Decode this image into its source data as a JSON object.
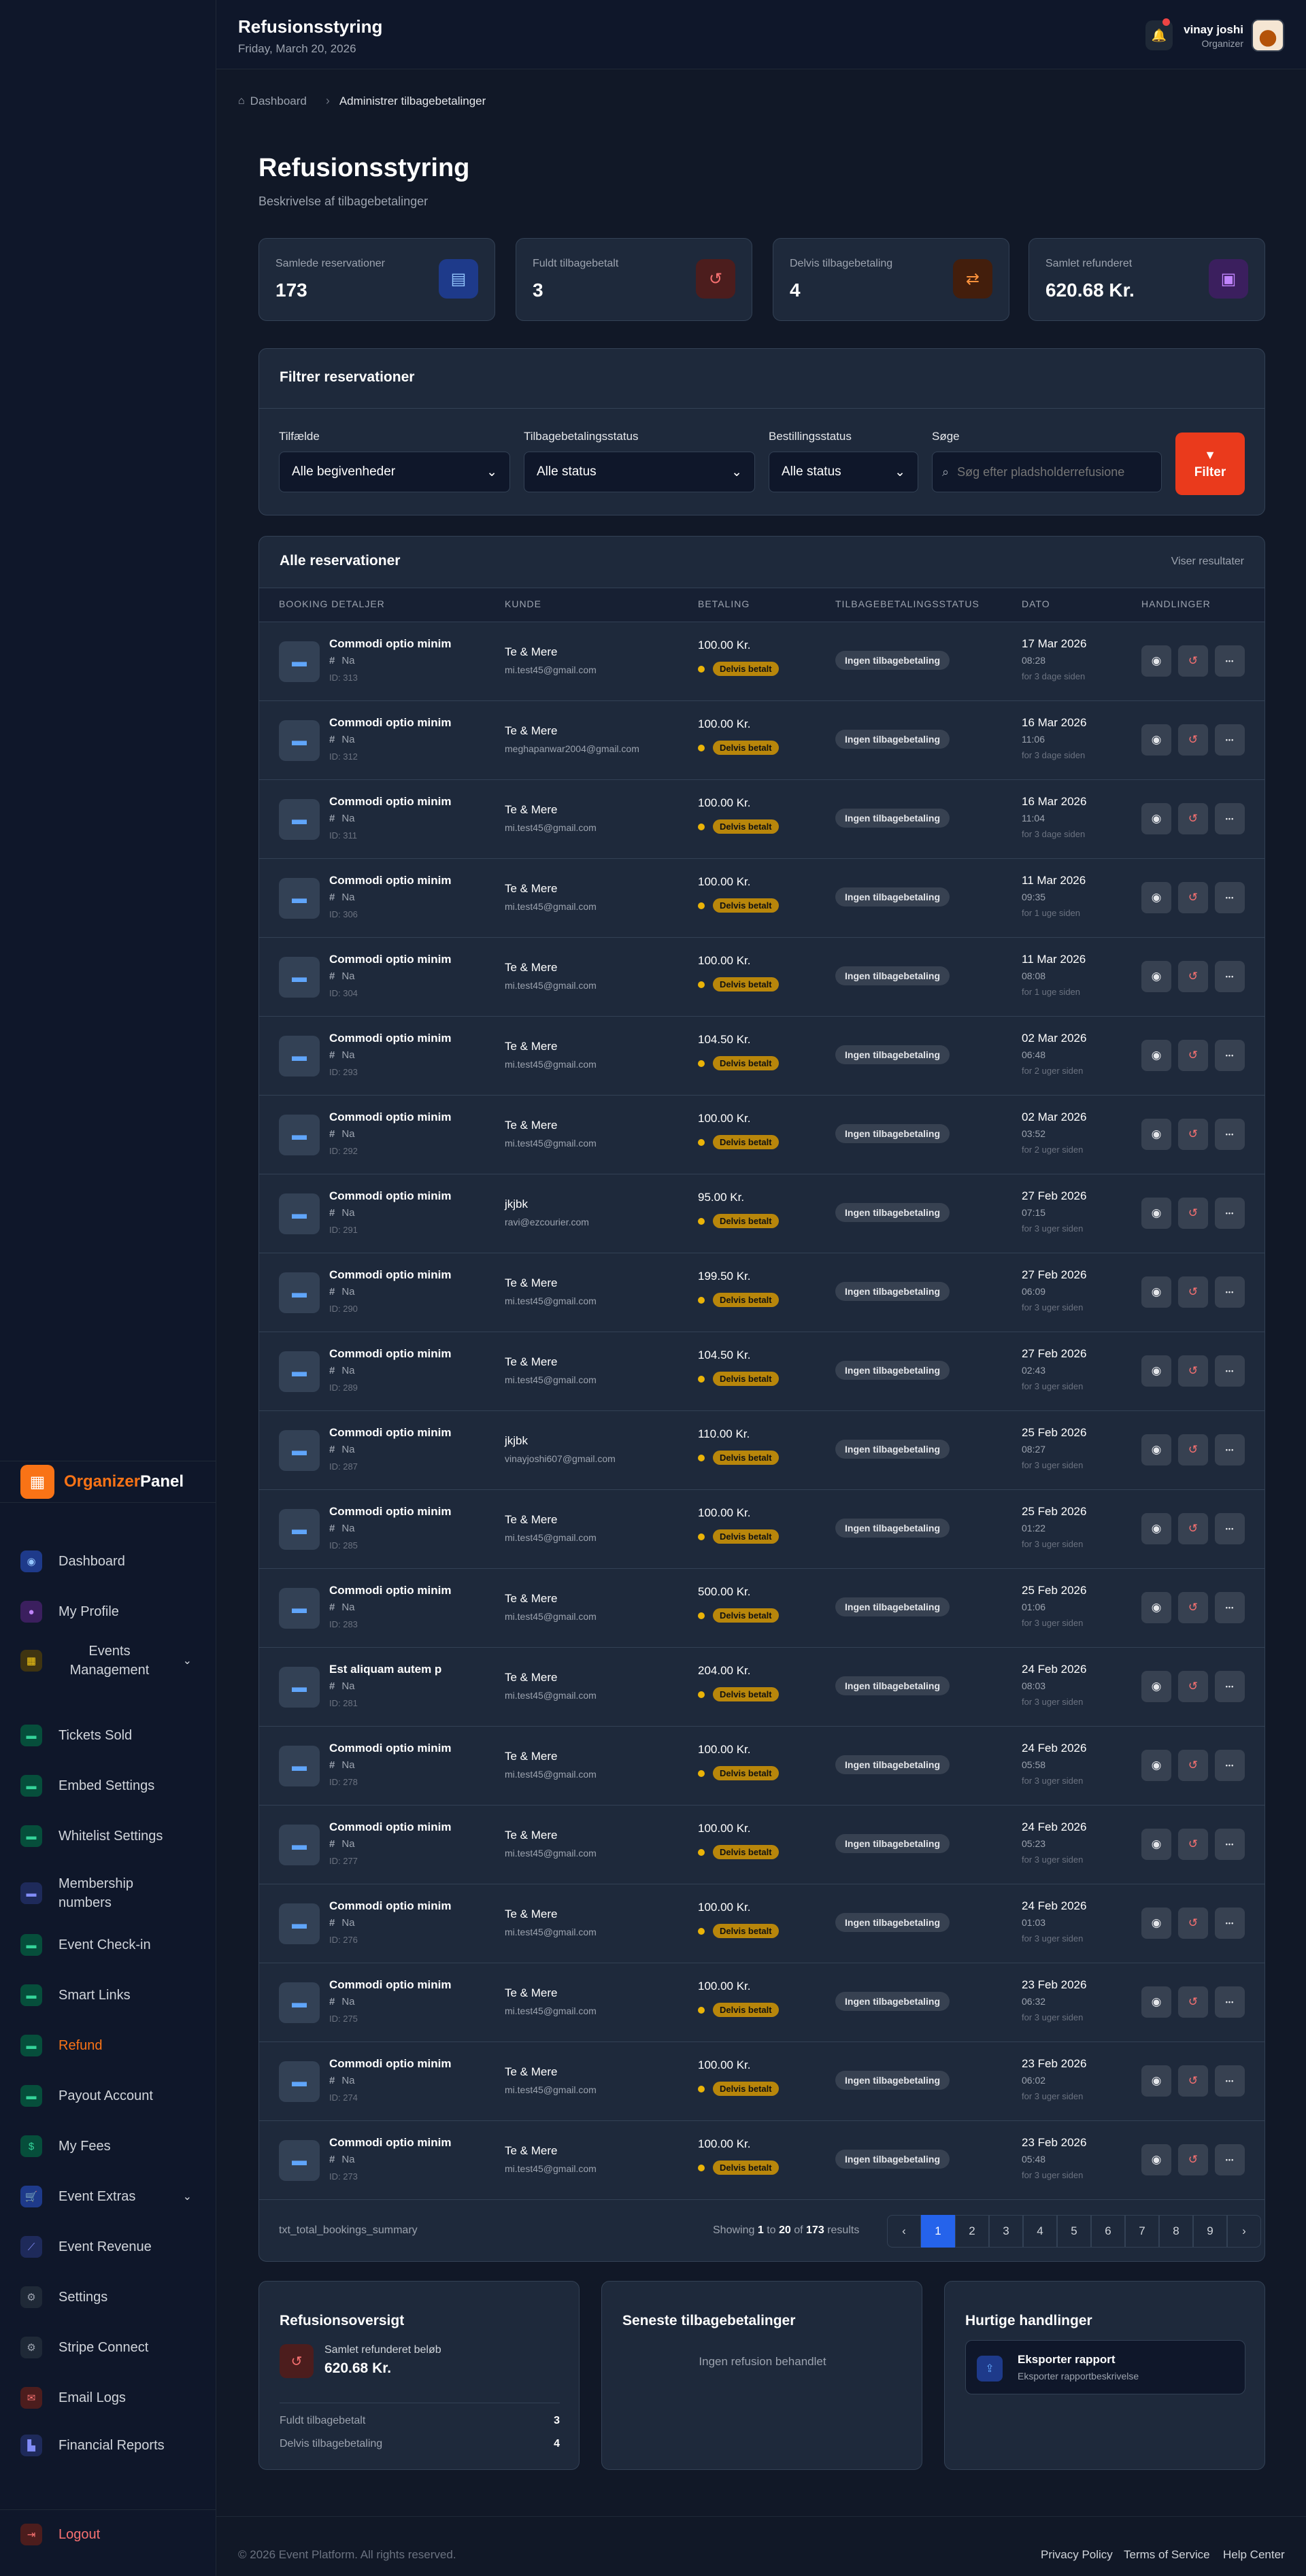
{
  "header": {
    "title": "Refusionsstyring",
    "date": "Friday, March 20, 2026",
    "user_name": "vinay joshi",
    "user_role": "Organizer"
  },
  "brand": {
    "part1": "Organizer",
    "part2": "Panel",
    "accent": "#f97316"
  },
  "sidebar": {
    "items": [
      {
        "label": "Dashboard",
        "icon": "gauge-icon",
        "glyph": "◉",
        "tone": "ic-blue"
      },
      {
        "label": "My Profile",
        "icon": "user-icon",
        "glyph": "●",
        "tone": "ic-purple"
      },
      {
        "label": "Events Management",
        "icon": "calendar-icon",
        "glyph": "▦",
        "tone": "ic-yellow"
      },
      {
        "label": "Tickets Sold",
        "icon": "ticket-icon",
        "glyph": "▬",
        "tone": "ic-green"
      },
      {
        "label": "Embed Settings",
        "icon": "code-icon",
        "glyph": "▬",
        "tone": "ic-green"
      },
      {
        "label": "Whitelist Settings",
        "icon": "list-icon",
        "glyph": "▬",
        "tone": "ic-green"
      },
      {
        "label": "Membership numbers",
        "icon": "id-card-icon",
        "glyph": "▬",
        "tone": "ic-indigo"
      },
      {
        "label": "Event Check-in",
        "icon": "checkin-icon",
        "glyph": "▬",
        "tone": "ic-green"
      },
      {
        "label": "Smart Links",
        "icon": "link-icon",
        "glyph": "▬",
        "tone": "ic-green"
      },
      {
        "label": "Refund",
        "icon": "refund-icon",
        "glyph": "▬",
        "tone": "ic-green"
      },
      {
        "label": "Payout Account",
        "icon": "bank-icon",
        "glyph": "▬",
        "tone": "ic-green"
      },
      {
        "label": "My Fees",
        "icon": "money-icon",
        "glyph": "$",
        "tone": "ic-green"
      },
      {
        "label": "Event Extras",
        "icon": "cart-icon",
        "glyph": "🛒",
        "tone": "ic-blue"
      },
      {
        "label": "Event Revenue",
        "icon": "chart-line-icon",
        "glyph": "⟋",
        "tone": "ic-indigo"
      },
      {
        "label": "Settings",
        "icon": "gear-icon",
        "glyph": "⚙",
        "tone": "ic-gray"
      },
      {
        "label": "Stripe Connect",
        "icon": "stripe-gear-icon",
        "glyph": "⚙",
        "tone": "ic-gray"
      },
      {
        "label": "Email Logs",
        "icon": "mail-icon",
        "glyph": "✉",
        "tone": "ic-red"
      },
      {
        "label": "Financial Reports",
        "icon": "bar-chart-icon",
        "glyph": "▙",
        "tone": "ic-indigo"
      }
    ],
    "logout": "Logout"
  },
  "breadcrumb": {
    "home": "Dashboard",
    "current": "Administrer tilbagebetalinger"
  },
  "page": {
    "title": "Refusionsstyring",
    "description": "Beskrivelse af tilbagebetalinger"
  },
  "stats": [
    {
      "label": "Samlede reservationer",
      "value": "173",
      "icon": "document-icon",
      "glyph": "▤",
      "tone": "ic-blue"
    },
    {
      "label": "Fuldt tilbagebetalt",
      "value": "3",
      "icon": "undo-icon",
      "glyph": "↺",
      "tone": "ic-red"
    },
    {
      "label": "Delvis tilbagebetaling",
      "value": "4",
      "icon": "exchange-icon",
      "glyph": "⇄",
      "tone": "ic-orange"
    },
    {
      "label": "Samlet refunderet",
      "value": "620.68 Kr.",
      "icon": "cash-icon",
      "glyph": "▣",
      "tone": "ic-purple"
    }
  ],
  "filters": {
    "title": "Filtrer reservationer",
    "event_label": "Tilfælde",
    "event_value": "Alle begivenheder",
    "refund_status_label": "Tilbagebetalingsstatus",
    "refund_status_value": "Alle status",
    "order_status_label": "Bestillingsstatus",
    "order_status_value": "Alle status",
    "search_label": "Søge",
    "search_placeholder": "Søg efter pladsholderrefusione",
    "button": "Filter"
  },
  "table": {
    "title": "Alle reservationer",
    "showing": "Viser resultater",
    "columns": [
      "BOOKING DETALJER",
      "KUNDE",
      "BETALING",
      "TILBAGEBETALINGSSTATUS",
      "DATO",
      "HANDLINGER"
    ],
    "rows": [
      {
        "title": "Commodi optio minim",
        "number": "Na",
        "id": "ID: 313",
        "customer": "Te & Mere",
        "email": "mi.test45@gmail.com",
        "amount": "100.00 Kr.",
        "pay_status": "Delvis betalt",
        "refund_status": "Ingen tilbagebetaling",
        "date": "17 Mar 2026",
        "time": "08:28",
        "ago": "for 3 dage siden"
      },
      {
        "title": "Commodi optio minim",
        "number": "Na",
        "id": "ID: 312",
        "customer": "Te & Mere",
        "email": "meghapanwar2004@gmail.com",
        "amount": "100.00 Kr.",
        "pay_status": "Delvis betalt",
        "refund_status": "Ingen tilbagebetaling",
        "date": "16 Mar 2026",
        "time": "11:06",
        "ago": "for 3 dage siden"
      },
      {
        "title": "Commodi optio minim",
        "number": "Na",
        "id": "ID: 311",
        "customer": "Te & Mere",
        "email": "mi.test45@gmail.com",
        "amount": "100.00 Kr.",
        "pay_status": "Delvis betalt",
        "refund_status": "Ingen tilbagebetaling",
        "date": "16 Mar 2026",
        "time": "11:04",
        "ago": "for 3 dage siden"
      },
      {
        "title": "Commodi optio minim",
        "number": "Na",
        "id": "ID: 306",
        "customer": "Te & Mere",
        "email": "mi.test45@gmail.com",
        "amount": "100.00 Kr.",
        "pay_status": "Delvis betalt",
        "refund_status": "Ingen tilbagebetaling",
        "date": "11 Mar 2026",
        "time": "09:35",
        "ago": "for 1 uge siden"
      },
      {
        "title": "Commodi optio minim",
        "number": "Na",
        "id": "ID: 304",
        "customer": "Te & Mere",
        "email": "mi.test45@gmail.com",
        "amount": "100.00 Kr.",
        "pay_status": "Delvis betalt",
        "refund_status": "Ingen tilbagebetaling",
        "date": "11 Mar 2026",
        "time": "08:08",
        "ago": "for 1 uge siden"
      },
      {
        "title": "Commodi optio minim",
        "number": "Na",
        "id": "ID: 293",
        "customer": "Te & Mere",
        "email": "mi.test45@gmail.com",
        "amount": "104.50 Kr.",
        "pay_status": "Delvis betalt",
        "refund_status": "Ingen tilbagebetaling",
        "date": "02 Mar 2026",
        "time": "06:48",
        "ago": "for 2 uger siden"
      },
      {
        "title": "Commodi optio minim",
        "number": "Na",
        "id": "ID: 292",
        "customer": "Te & Mere",
        "email": "mi.test45@gmail.com",
        "amount": "100.00 Kr.",
        "pay_status": "Delvis betalt",
        "refund_status": "Ingen tilbagebetaling",
        "date": "02 Mar 2026",
        "time": "03:52",
        "ago": "for 2 uger siden"
      },
      {
        "title": "Commodi optio minim",
        "number": "Na",
        "id": "ID: 291",
        "customer": "jkjbk",
        "email": "ravi@ezcourier.com",
        "amount": "95.00 Kr.",
        "pay_status": "Delvis betalt",
        "refund_status": "Ingen tilbagebetaling",
        "date": "27 Feb 2026",
        "time": "07:15",
        "ago": "for 3 uger siden"
      },
      {
        "title": "Commodi optio minim",
        "number": "Na",
        "id": "ID: 290",
        "customer": "Te & Mere",
        "email": "mi.test45@gmail.com",
        "amount": "199.50 Kr.",
        "pay_status": "Delvis betalt",
        "refund_status": "Ingen tilbagebetaling",
        "date": "27 Feb 2026",
        "time": "06:09",
        "ago": "for 3 uger siden"
      },
      {
        "title": "Commodi optio minim",
        "number": "Na",
        "id": "ID: 289",
        "customer": "Te & Mere",
        "email": "mi.test45@gmail.com",
        "amount": "104.50 Kr.",
        "pay_status": "Delvis betalt",
        "refund_status": "Ingen tilbagebetaling",
        "date": "27 Feb 2026",
        "time": "02:43",
        "ago": "for 3 uger siden"
      },
      {
        "title": "Commodi optio minim",
        "number": "Na",
        "id": "ID: 287",
        "customer": "jkjbk",
        "email": "vinayjoshi607@gmail.com",
        "amount": "110.00 Kr.",
        "pay_status": "Delvis betalt",
        "refund_status": "Ingen tilbagebetaling",
        "date": "25 Feb 2026",
        "time": "08:27",
        "ago": "for 3 uger siden"
      },
      {
        "title": "Commodi optio minim",
        "number": "Na",
        "id": "ID: 285",
        "customer": "Te & Mere",
        "email": "mi.test45@gmail.com",
        "amount": "100.00 Kr.",
        "pay_status": "Delvis betalt",
        "refund_status": "Ingen tilbagebetaling",
        "date": "25 Feb 2026",
        "time": "01:22",
        "ago": "for 3 uger siden"
      },
      {
        "title": "Commodi optio minim",
        "number": "Na",
        "id": "ID: 283",
        "customer": "Te & Mere",
        "email": "mi.test45@gmail.com",
        "amount": "500.00 Kr.",
        "pay_status": "Delvis betalt",
        "refund_status": "Ingen tilbagebetaling",
        "date": "25 Feb 2026",
        "time": "01:06",
        "ago": "for 3 uger siden"
      },
      {
        "title": "Est aliquam autem p",
        "number": "Na",
        "id": "ID: 281",
        "customer": "Te & Mere",
        "email": "mi.test45@gmail.com",
        "amount": "204.00 Kr.",
        "pay_status": "Delvis betalt",
        "refund_status": "Ingen tilbagebetaling",
        "date": "24 Feb 2026",
        "time": "08:03",
        "ago": "for 3 uger siden"
      },
      {
        "title": "Commodi optio minim",
        "number": "Na",
        "id": "ID: 278",
        "customer": "Te & Mere",
        "email": "mi.test45@gmail.com",
        "amount": "100.00 Kr.",
        "pay_status": "Delvis betalt",
        "refund_status": "Ingen tilbagebetaling",
        "date": "24 Feb 2026",
        "time": "05:58",
        "ago": "for 3 uger siden"
      },
      {
        "title": "Commodi optio minim",
        "number": "Na",
        "id": "ID: 277",
        "customer": "Te & Mere",
        "email": "mi.test45@gmail.com",
        "amount": "100.00 Kr.",
        "pay_status": "Delvis betalt",
        "refund_status": "Ingen tilbagebetaling",
        "date": "24 Feb 2026",
        "time": "05:23",
        "ago": "for 3 uger siden"
      },
      {
        "title": "Commodi optio minim",
        "number": "Na",
        "id": "ID: 276",
        "customer": "Te & Mere",
        "email": "mi.test45@gmail.com",
        "amount": "100.00 Kr.",
        "pay_status": "Delvis betalt",
        "refund_status": "Ingen tilbagebetaling",
        "date": "24 Feb 2026",
        "time": "01:03",
        "ago": "for 3 uger siden"
      },
      {
        "title": "Commodi optio minim",
        "number": "Na",
        "id": "ID: 275",
        "customer": "Te & Mere",
        "email": "mi.test45@gmail.com",
        "amount": "100.00 Kr.",
        "pay_status": "Delvis betalt",
        "refund_status": "Ingen tilbagebetaling",
        "date": "23 Feb 2026",
        "time": "06:32",
        "ago": "for 3 uger siden"
      },
      {
        "title": "Commodi optio minim",
        "number": "Na",
        "id": "ID: 274",
        "customer": "Te & Mere",
        "email": "mi.test45@gmail.com",
        "amount": "100.00 Kr.",
        "pay_status": "Delvis betalt",
        "refund_status": "Ingen tilbagebetaling",
        "date": "23 Feb 2026",
        "time": "06:02",
        "ago": "for 3 uger siden"
      },
      {
        "title": "Commodi optio minim",
        "number": "Na",
        "id": "ID: 273",
        "customer": "Te & Mere",
        "email": "mi.test45@gmail.com",
        "amount": "100.00 Kr.",
        "pay_status": "Delvis betalt",
        "refund_status": "Ingen tilbagebetaling",
        "date": "23 Feb 2026",
        "time": "05:48",
        "ago": "for 3 uger siden"
      }
    ],
    "summary_key": "txt_total_bookings_summary",
    "results_prefix": "Showing",
    "results_from": "1",
    "results_to_word": "to",
    "results_to": "20",
    "results_of_word": "of",
    "results_total": "173",
    "results_suffix": "results",
    "pages": [
      "‹",
      "1",
      "2",
      "3",
      "4",
      "5",
      "6",
      "7",
      "8",
      "9",
      "›"
    ],
    "current_page": "1"
  },
  "refund_overview": {
    "title": "Refusionsoversigt",
    "total_label": "Samlet refunderet beløb",
    "total_value": "620.68 Kr.",
    "full_label": "Fuldt tilbagebetalt",
    "full_value": "3",
    "partial_label": "Delvis tilbagebetaling",
    "partial_value": "4"
  },
  "recent_refunds": {
    "title": "Seneste tilbagebetalinger",
    "empty": "Ingen refusion behandlet"
  },
  "quick_actions": {
    "title": "Hurtige handlinger",
    "export_title": "Eksporter rapport",
    "export_desc": "Eksporter rapportbeskrivelse"
  },
  "footer": {
    "copyright": "© 2026 Event Platform. All rights reserved.",
    "privacy": "Privacy Policy",
    "terms": "Terms of Service",
    "help": "Help Center"
  }
}
